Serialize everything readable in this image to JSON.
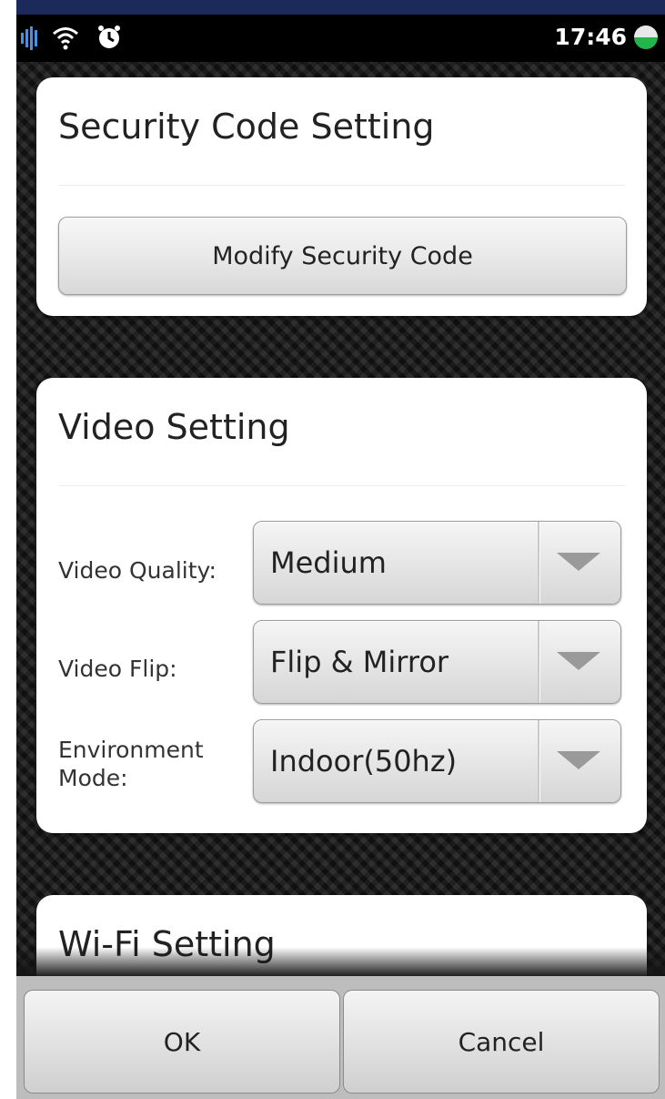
{
  "status_bar": {
    "time": "17:46",
    "icons": [
      "signal-icon",
      "wifi-icon",
      "alarm-icon",
      "battery-icon"
    ],
    "battery_color": "#25b34b"
  },
  "security_section": {
    "title": "Security Code Setting",
    "modify_button": "Modify Security Code"
  },
  "video_section": {
    "title": "Video Setting",
    "fields": [
      {
        "label": "Video Quality:",
        "value": "Medium"
      },
      {
        "label": "Video Flip:",
        "value": "Flip & Mirror"
      },
      {
        "label": "Environment\nMode:",
        "value": "Indoor(50hz)"
      }
    ]
  },
  "wifi_section": {
    "title": "Wi-Fi Setting"
  },
  "bottom_bar": {
    "ok_label": "OK",
    "cancel_label": "Cancel"
  }
}
